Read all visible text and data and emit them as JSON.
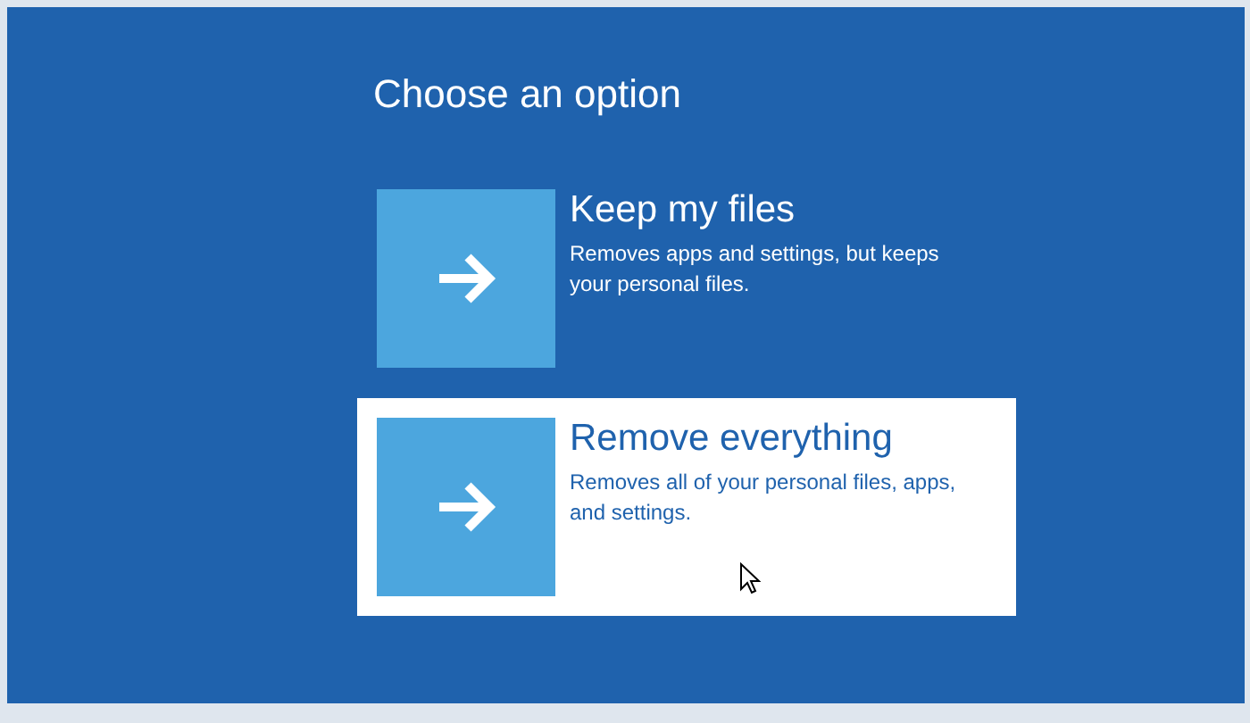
{
  "title": "Choose an option",
  "options": [
    {
      "title": "Keep my files",
      "description": "Removes apps and settings, but keeps your personal files.",
      "selected": false
    },
    {
      "title": "Remove everything",
      "description": "Removes all of your personal files, apps, and settings.",
      "selected": true
    }
  ]
}
